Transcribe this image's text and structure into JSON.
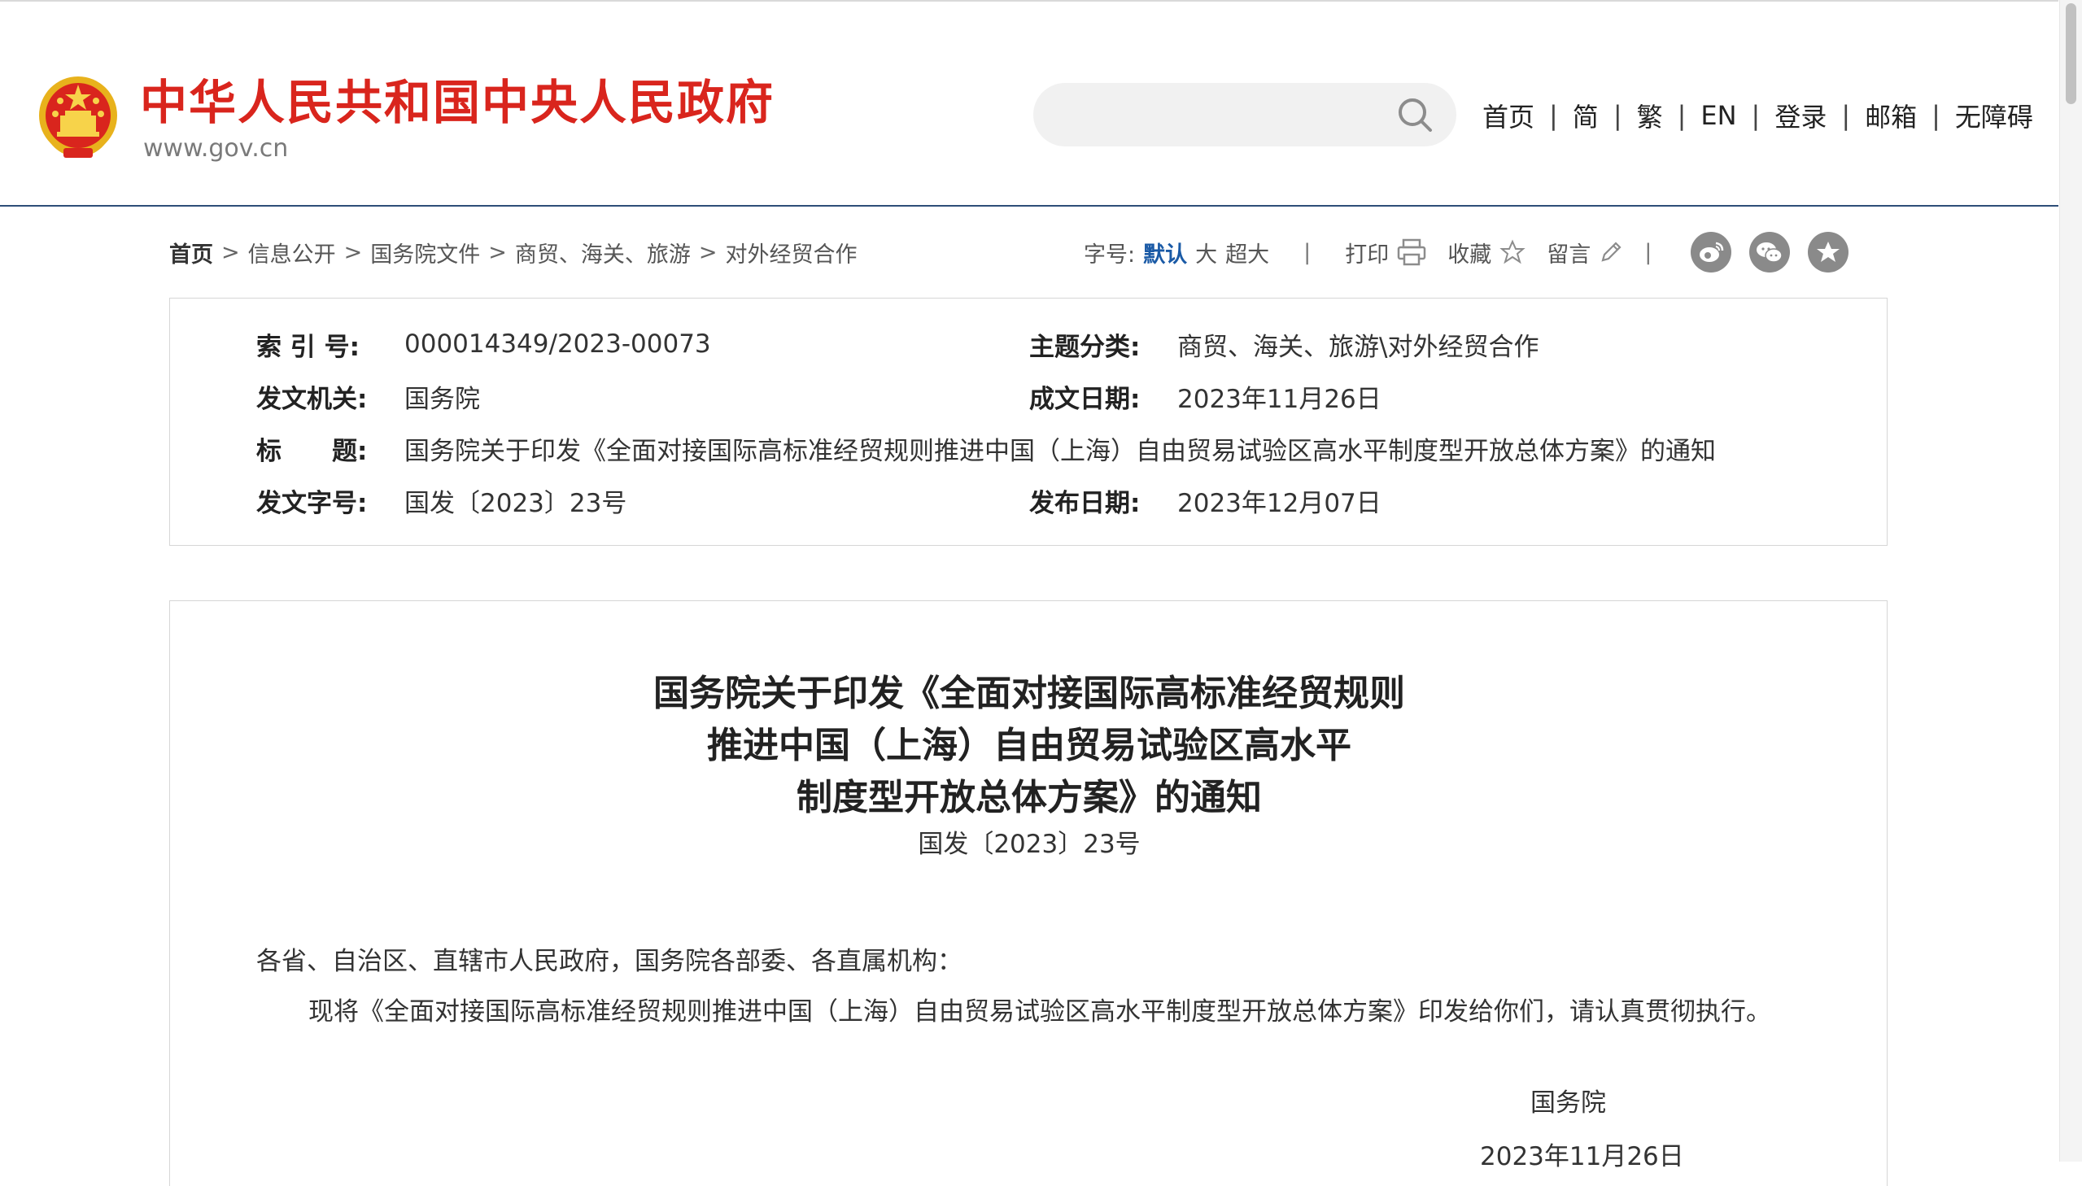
{
  "header": {
    "site_title": "中华人民共和国中央人民政府",
    "site_url": "www.gov.cn",
    "search": {
      "placeholder": "",
      "value": ""
    },
    "nav": [
      {
        "label": "首页"
      },
      {
        "label": "简"
      },
      {
        "label": "繁"
      },
      {
        "label": "EN"
      },
      {
        "label": "登录"
      },
      {
        "label": "邮箱"
      },
      {
        "label": "无障碍"
      }
    ],
    "nav_separator": "|"
  },
  "breadcrumb": {
    "items": [
      {
        "label": "首页"
      },
      {
        "label": "信息公开"
      },
      {
        "label": "国务院文件"
      },
      {
        "label": "商贸、海关、旅游"
      },
      {
        "label": "对外经贸合作"
      }
    ],
    "separator": ">"
  },
  "tools": {
    "font_size_label": "字号:",
    "font_sizes": [
      "默认",
      "大",
      "超大"
    ],
    "active_font_size": "默认",
    "separator": "|",
    "print_label": "打印",
    "favorite_label": "收藏",
    "comment_label": "留言",
    "share_icons": [
      "weibo-icon",
      "wechat-icon",
      "qzone-icon"
    ]
  },
  "meta": {
    "index_label": "索 引 号:",
    "index_value": "000014349/2023-00073",
    "category_label": "主题分类:",
    "category_value": "商贸、海关、旅游\\对外经贸合作",
    "issuer_label": "发文机关:",
    "issuer_value": "国务院",
    "created_label": "成文日期:",
    "created_value": "2023年11月26日",
    "title_label": "标　　题:",
    "title_value": "国务院关于印发《全面对接国际高标准经贸规则推进中国（上海）自由贸易试验区高水平制度型开放总体方案》的通知",
    "docno_label": "发文字号:",
    "docno_value": "国发〔2023〕23号",
    "published_label": "发布日期:",
    "published_value": "2023年12月07日"
  },
  "document": {
    "title_lines": [
      "国务院关于印发《全面对接国际高标准经贸规则",
      "推进中国（上海）自由贸易试验区高水平",
      "制度型开放总体方案》的通知"
    ],
    "doc_number": "国发〔2023〕23号",
    "salutation": "各省、自治区、直辖市人民政府，国务院各部委、各直属机构：",
    "body": "现将《全面对接国际高标准经贸规则推进中国（上海）自由贸易试验区高水平制度型开放总体方案》印发给你们，请认真贯彻执行。",
    "signature": "国务院",
    "sign_date": "2023年11月26日"
  },
  "colors": {
    "brand_red": "#d9251d",
    "header_rule": "#2e4e78",
    "active_link": "#1a5aa6",
    "border": "#d6d6d6"
  }
}
